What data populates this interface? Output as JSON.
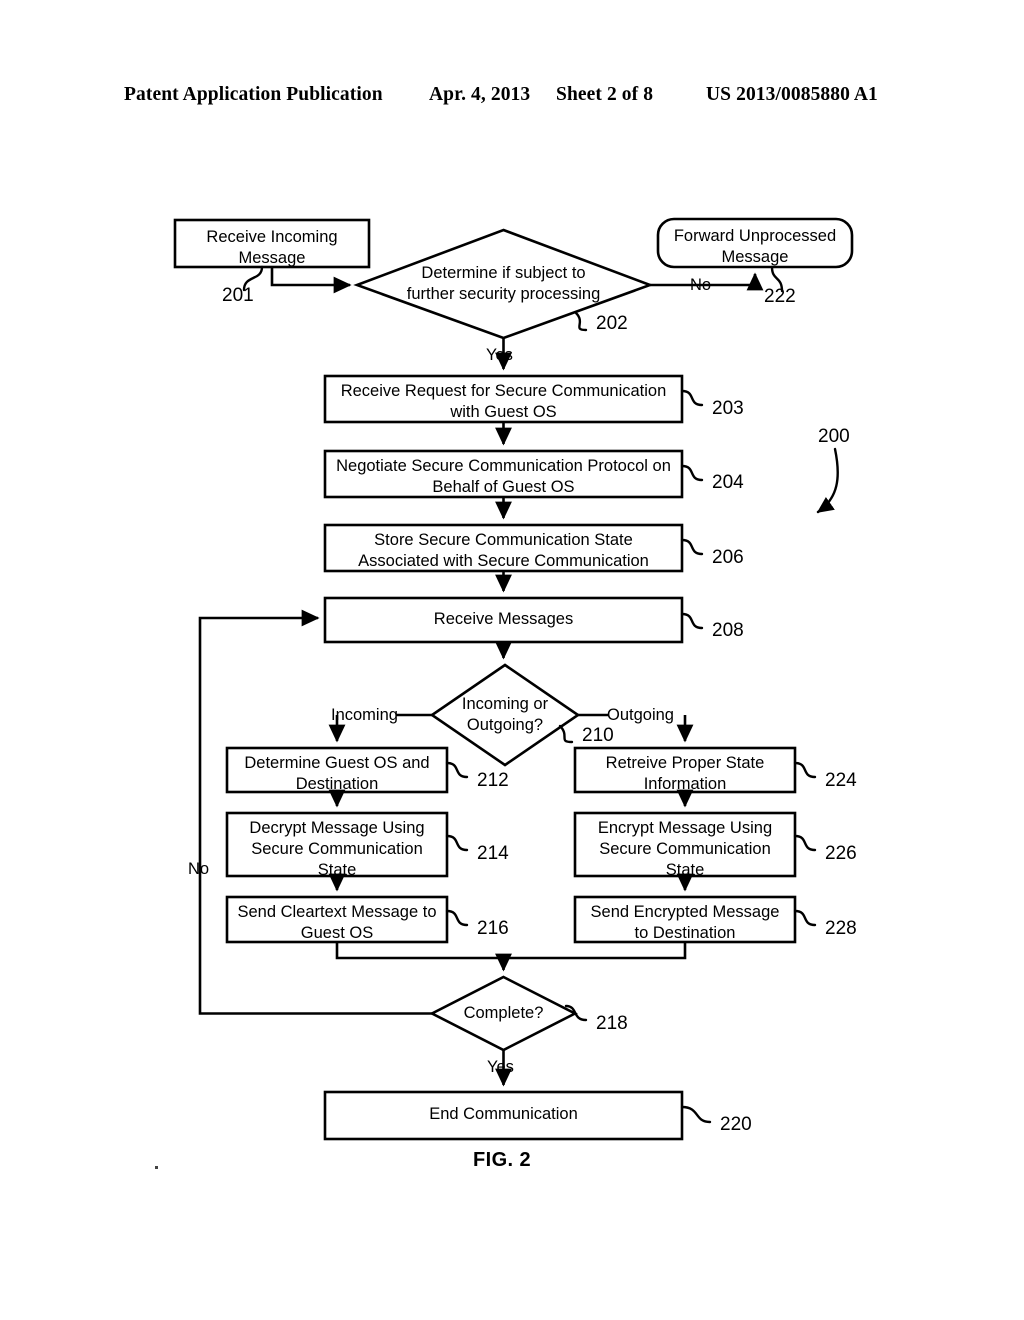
{
  "header": {
    "publication": "Patent Application Publication",
    "date": "Apr. 4, 2013",
    "sheet": "Sheet 2 of 8",
    "number": "US 2013/0085880 A1"
  },
  "figure": {
    "caption": "FIG. 2",
    "diagram_ref": "200"
  },
  "nodes": [
    {
      "id": "n201",
      "ref": "201",
      "shape": "rect",
      "lines": [
        "Receive Incoming",
        "Message"
      ]
    },
    {
      "id": "n202",
      "ref": "202",
      "shape": "diamond",
      "lines": [
        "Determine if subject to",
        "further security processing"
      ]
    },
    {
      "id": "n222",
      "ref": "222",
      "shape": "rounded-rect",
      "lines": [
        "Forward Unprocessed",
        "Message"
      ]
    },
    {
      "id": "n203",
      "ref": "203",
      "shape": "rect",
      "lines": [
        "Receive Request for Secure Communication",
        "with Guest OS"
      ]
    },
    {
      "id": "n204",
      "ref": "204",
      "shape": "rect",
      "lines": [
        "Negotiate Secure Communication Protocol on",
        "Behalf of Guest OS"
      ]
    },
    {
      "id": "n206",
      "ref": "206",
      "shape": "rect",
      "lines": [
        "Store Secure Communication State",
        "Associated with Secure Communication"
      ]
    },
    {
      "id": "n208",
      "ref": "208",
      "shape": "rect",
      "lines": [
        "Receive Messages"
      ]
    },
    {
      "id": "n210",
      "ref": "210",
      "shape": "diamond",
      "lines": [
        "Incoming or",
        "Outgoing?"
      ]
    },
    {
      "id": "n212",
      "ref": "212",
      "shape": "rect",
      "lines": [
        "Determine Guest OS and",
        "Destination"
      ]
    },
    {
      "id": "n214",
      "ref": "214",
      "shape": "rect",
      "lines": [
        "Decrypt Message Using",
        "Secure Communication",
        "State"
      ]
    },
    {
      "id": "n216",
      "ref": "216",
      "shape": "rect",
      "lines": [
        "Send Cleartext Message to",
        "Guest OS"
      ]
    },
    {
      "id": "n224",
      "ref": "224",
      "shape": "rect",
      "lines": [
        "Retreive Proper State",
        "Information"
      ]
    },
    {
      "id": "n226",
      "ref": "226",
      "shape": "rect",
      "lines": [
        "Encrypt Message Using",
        "Secure Communication",
        "State"
      ]
    },
    {
      "id": "n228",
      "ref": "228",
      "shape": "rect",
      "lines": [
        "Send Encrypted Message",
        "to Destination"
      ]
    },
    {
      "id": "n218",
      "ref": "218",
      "shape": "diamond",
      "lines": [
        "Complete?"
      ]
    },
    {
      "id": "n220",
      "ref": "220",
      "shape": "rect",
      "lines": [
        "End Communication"
      ]
    }
  ],
  "edge_labels": {
    "d202_no": "No",
    "d202_yes": "Yes",
    "d210_incoming": "Incoming",
    "d210_outgoing": "Outgoing",
    "d218_no": "No",
    "d218_yes": "Yes"
  },
  "colors": {
    "stroke": "#000000",
    "fill": "#ffffff",
    "text": "#000000"
  }
}
